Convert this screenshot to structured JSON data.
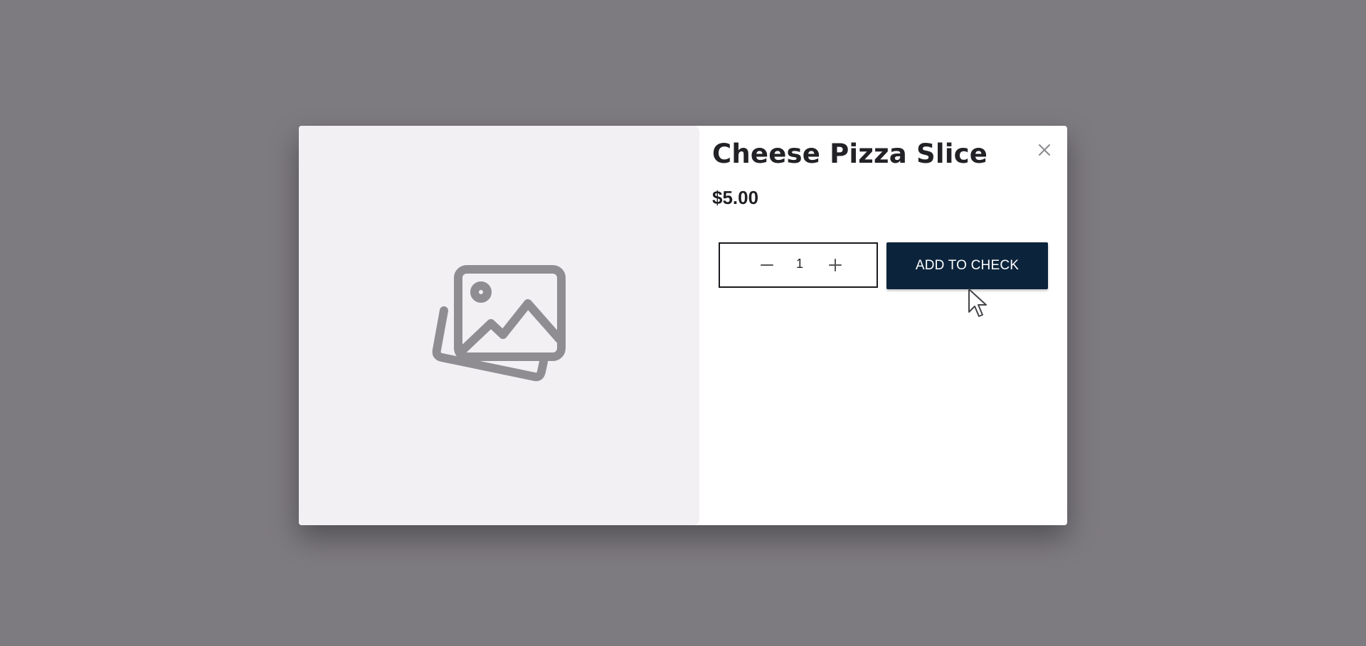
{
  "colors": {
    "backdrop": "#7e7b80",
    "image_panel": "#f2f0f3",
    "button_bg": "#0c243b",
    "button_text": "#ffffff",
    "title_text": "#222125"
  },
  "product": {
    "title": "Cheese Pizza Slice",
    "price": "$5.00",
    "image_icon": "image-placeholder-icon"
  },
  "quantity": {
    "value": "1",
    "minus_icon": "minus-icon",
    "plus_icon": "plus-icon"
  },
  "actions": {
    "add_label": "ADD TO CHECK",
    "close_icon": "close-icon"
  }
}
